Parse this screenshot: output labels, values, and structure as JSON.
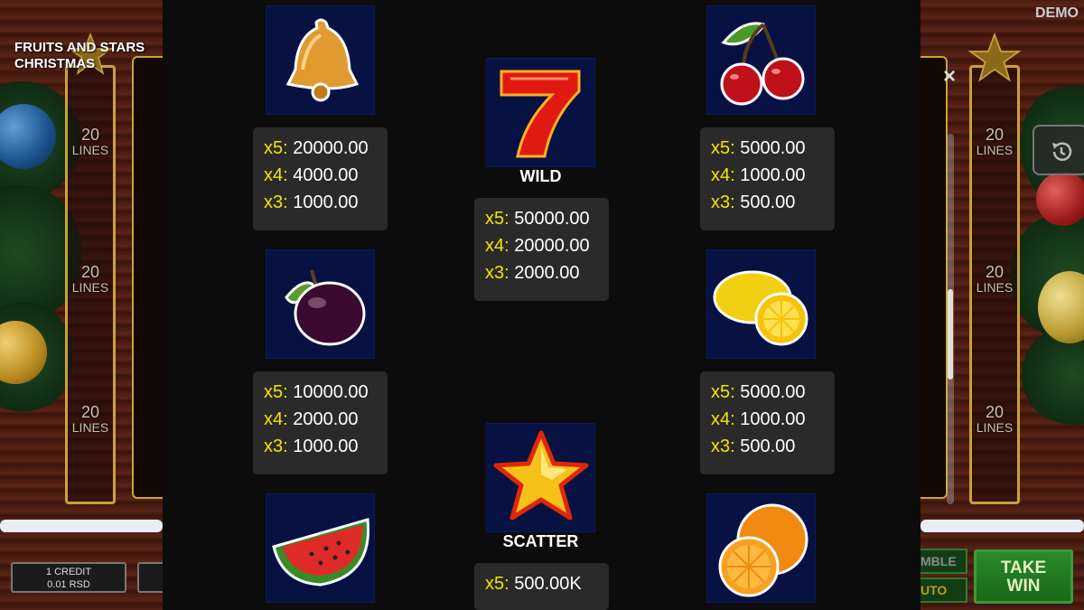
{
  "game": {
    "title_line1": "FRUITS AND STARS",
    "title_line2": "CHRISTMAS",
    "mode": "DEMO",
    "lines_value": "20",
    "lines_label": "LINES",
    "credit_line1": "1 CREDIT",
    "credit_line2": "0.01 RSD",
    "gamble_partial": "MBLE",
    "auto_partial": "UTO",
    "take_win_line1": "TAKE",
    "take_win_line2": "WIN"
  },
  "paytable": {
    "close_label": "×",
    "symbols": [
      {
        "id": "bell",
        "caption": "",
        "pays": [
          {
            "mult": "x5:",
            "value": "20000.00"
          },
          {
            "mult": "x4:",
            "value": "4000.00"
          },
          {
            "mult": "x3:",
            "value": "1000.00"
          }
        ]
      },
      {
        "id": "seven",
        "caption": "WILD",
        "pays": [
          {
            "mult": "x5:",
            "value": "50000.00"
          },
          {
            "mult": "x4:",
            "value": "20000.00"
          },
          {
            "mult": "x3:",
            "value": "2000.00"
          }
        ]
      },
      {
        "id": "cherry",
        "caption": "",
        "pays": [
          {
            "mult": "x5:",
            "value": "5000.00"
          },
          {
            "mult": "x4:",
            "value": "1000.00"
          },
          {
            "mult": "x3:",
            "value": "500.00"
          }
        ]
      },
      {
        "id": "plum",
        "caption": "",
        "pays": [
          {
            "mult": "x5:",
            "value": "10000.00"
          },
          {
            "mult": "x4:",
            "value": "2000.00"
          },
          {
            "mult": "x3:",
            "value": "1000.00"
          }
        ]
      },
      {
        "id": "lemon",
        "caption": "",
        "pays": [
          {
            "mult": "x5:",
            "value": "5000.00"
          },
          {
            "mult": "x4:",
            "value": "1000.00"
          },
          {
            "mult": "x3:",
            "value": "500.00"
          }
        ]
      },
      {
        "id": "watermelon",
        "caption": "",
        "pays": []
      },
      {
        "id": "star",
        "caption": "SCATTER",
        "pays": [
          {
            "mult": "x5:",
            "value": "500.00K"
          }
        ]
      },
      {
        "id": "orange",
        "caption": "",
        "pays": []
      }
    ]
  },
  "colors": {
    "multiplier": "#f2e600",
    "symbol_bg": "#071243",
    "pay_box_bg": "#2a2a2a",
    "take_win": "#2a8a2a"
  }
}
